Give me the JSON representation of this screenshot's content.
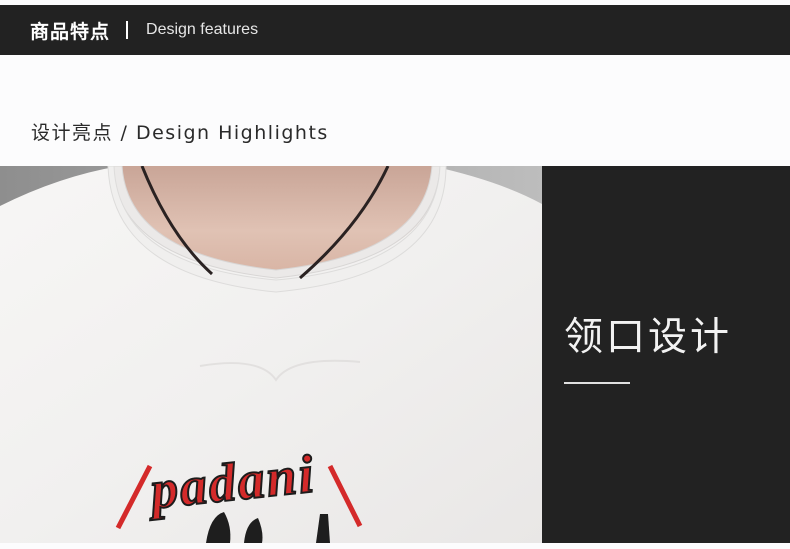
{
  "header": {
    "title_cn": "商品特点",
    "title_en": "Design features"
  },
  "section": {
    "title": "设计亮点 / Design Highlights"
  },
  "photo": {
    "description_icon": "tshirt-collar-photo",
    "print_text": "padani"
  },
  "panel": {
    "title": "领口设计"
  },
  "colors": {
    "dark": "#222222",
    "page_bg": "#fcfcfd",
    "print_red": "#d42a2a"
  }
}
